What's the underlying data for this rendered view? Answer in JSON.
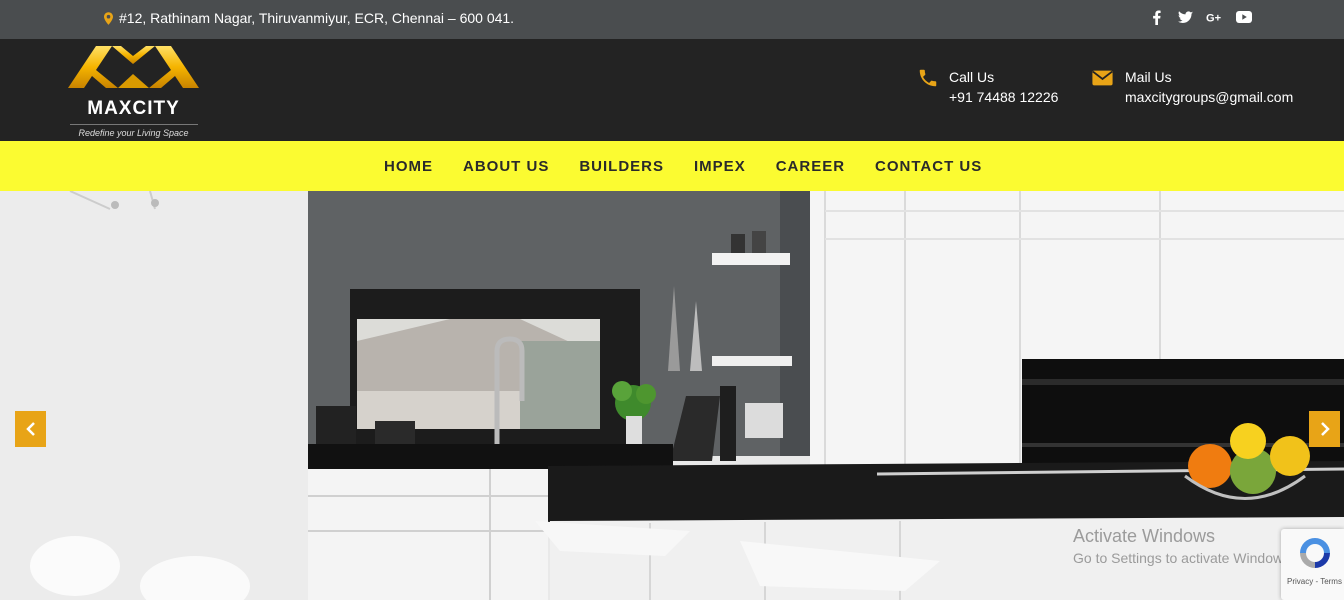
{
  "topbar": {
    "address": "#12, Rathinam Nagar, Thiruvanmiyur, ECR, Chennai – 600 041.",
    "social": [
      "facebook-icon",
      "twitter-icon",
      "google-plus-icon",
      "youtube-icon"
    ]
  },
  "header": {
    "brand": "MAXCITY",
    "tagline": "Redefine your Living Space",
    "call_label": "Call Us",
    "call_value": "+91 74488 12226",
    "mail_label": "Mail Us",
    "mail_value": "maxcitygroups@gmail.com"
  },
  "nav": {
    "items": [
      {
        "label": "HOME"
      },
      {
        "label": "ABOUT US"
      },
      {
        "label": "BUILDERS"
      },
      {
        "label": "IMPEX"
      },
      {
        "label": "CAREER"
      },
      {
        "label": "CONTACT US"
      }
    ]
  },
  "hero": {
    "image": "kitchen-interior-photo"
  },
  "system": {
    "watermark_title": "Activate Windows",
    "watermark_sub": "Go to Settings to activate Windows.",
    "recaptcha_text": "Privacy - Terms"
  },
  "colors": {
    "topbar": "#4a4d4f",
    "header": "#232323",
    "nav": "#fbfb31",
    "accent": "#e8a417"
  }
}
